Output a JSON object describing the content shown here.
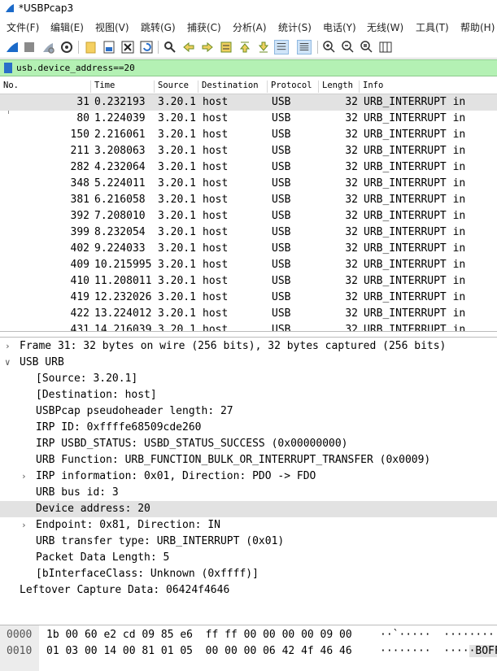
{
  "window": {
    "title": "*USBPcap3"
  },
  "menu": [
    "文件(F)",
    "编辑(E)",
    "视图(V)",
    "跳转(G)",
    "捕获(C)",
    "分析(A)",
    "统计(S)",
    "电话(Y)",
    "无线(W)",
    "工具(T)",
    "帮助(H)"
  ],
  "toolbar": {
    "icons": [
      "shark-fin-start-icon",
      "stop-icon",
      "restart-icon",
      "options-gear-icon",
      "open-folder-icon",
      "save-icon",
      "close-file-icon",
      "reload-icon",
      "find-icon",
      "back-arrow-icon",
      "forward-arrow-icon",
      "goto-packet-icon",
      "first-packet-icon",
      "last-packet-icon",
      "autoscroll-icon",
      "colorize-icon",
      "zoom-in-icon",
      "zoom-out-icon",
      "zoom-normal-icon",
      "resize-columns-icon"
    ]
  },
  "filter": {
    "value": "usb.device_address==20"
  },
  "columns": [
    "No.",
    "Time",
    "Source",
    "Destination",
    "Protocol",
    "Length",
    "Info"
  ],
  "packets": [
    {
      "no": "31",
      "time": "0.232193",
      "source": "3.20.1",
      "destination": "host",
      "protocol": "USB",
      "length": "32",
      "info": "URB_INTERRUPT in"
    },
    {
      "no": "80",
      "time": "1.224039",
      "source": "3.20.1",
      "destination": "host",
      "protocol": "USB",
      "length": "32",
      "info": "URB_INTERRUPT in"
    },
    {
      "no": "150",
      "time": "2.216061",
      "source": "3.20.1",
      "destination": "host",
      "protocol": "USB",
      "length": "32",
      "info": "URB_INTERRUPT in"
    },
    {
      "no": "211",
      "time": "3.208063",
      "source": "3.20.1",
      "destination": "host",
      "protocol": "USB",
      "length": "32",
      "info": "URB_INTERRUPT in"
    },
    {
      "no": "282",
      "time": "4.232064",
      "source": "3.20.1",
      "destination": "host",
      "protocol": "USB",
      "length": "32",
      "info": "URB_INTERRUPT in"
    },
    {
      "no": "348",
      "time": "5.224011",
      "source": "3.20.1",
      "destination": "host",
      "protocol": "USB",
      "length": "32",
      "info": "URB_INTERRUPT in"
    },
    {
      "no": "381",
      "time": "6.216058",
      "source": "3.20.1",
      "destination": "host",
      "protocol": "USB",
      "length": "32",
      "info": "URB_INTERRUPT in"
    },
    {
      "no": "392",
      "time": "7.208010",
      "source": "3.20.1",
      "destination": "host",
      "protocol": "USB",
      "length": "32",
      "info": "URB_INTERRUPT in"
    },
    {
      "no": "399",
      "time": "8.232054",
      "source": "3.20.1",
      "destination": "host",
      "protocol": "USB",
      "length": "32",
      "info": "URB_INTERRUPT in"
    },
    {
      "no": "402",
      "time": "9.224033",
      "source": "3.20.1",
      "destination": "host",
      "protocol": "USB",
      "length": "32",
      "info": "URB_INTERRUPT in"
    },
    {
      "no": "409",
      "time": "10.215995",
      "source": "3.20.1",
      "destination": "host",
      "protocol": "USB",
      "length": "32",
      "info": "URB_INTERRUPT in"
    },
    {
      "no": "410",
      "time": "11.208011",
      "source": "3.20.1",
      "destination": "host",
      "protocol": "USB",
      "length": "32",
      "info": "URB_INTERRUPT in"
    },
    {
      "no": "419",
      "time": "12.232026",
      "source": "3.20.1",
      "destination": "host",
      "protocol": "USB",
      "length": "32",
      "info": "URB_INTERRUPT in"
    },
    {
      "no": "422",
      "time": "13.224012",
      "source": "3.20.1",
      "destination": "host",
      "protocol": "USB",
      "length": "32",
      "info": "URB_INTERRUPT in"
    },
    {
      "no": "431",
      "time": "14.216039",
      "source": "3.20.1",
      "destination": "host",
      "protocol": "USB",
      "length": "32",
      "info": "URB_INTERRUPT in"
    }
  ],
  "details": [
    {
      "text": "Frame 31: 32 bytes on wire (256 bits), 32 bytes captured (256 bits)",
      "level": 0,
      "arrow": "collapsed"
    },
    {
      "text": "USB URB",
      "level": 0,
      "arrow": "expanded"
    },
    {
      "text": "[Source: 3.20.1]",
      "level": 1,
      "arrow": "none"
    },
    {
      "text": "[Destination: host]",
      "level": 1,
      "arrow": "none"
    },
    {
      "text": "USBPcap pseudoheader length: 27",
      "level": 1,
      "arrow": "none"
    },
    {
      "text": "IRP ID: 0xffffe68509cde260",
      "level": 1,
      "arrow": "none"
    },
    {
      "text": "IRP USBD_STATUS: USBD_STATUS_SUCCESS (0x00000000)",
      "level": 1,
      "arrow": "none"
    },
    {
      "text": "URB Function: URB_FUNCTION_BULK_OR_INTERRUPT_TRANSFER (0x0009)",
      "level": 1,
      "arrow": "none"
    },
    {
      "text": "IRP information: 0x01, Direction: PDO -> FDO",
      "level": 1,
      "arrow": "collapsed"
    },
    {
      "text": "URB bus id: 3",
      "level": 1,
      "arrow": "none"
    },
    {
      "text": "Device address: 20",
      "level": 1,
      "arrow": "none",
      "highlighted": true
    },
    {
      "text": "Endpoint: 0x81, Direction: IN",
      "level": 1,
      "arrow": "collapsed"
    },
    {
      "text": "URB transfer type: URB_INTERRUPT (0x01)",
      "level": 1,
      "arrow": "none"
    },
    {
      "text": "Packet Data Length: 5",
      "level": 1,
      "arrow": "none"
    },
    {
      "text": "[bInterfaceClass: Unknown (0xffff)]",
      "level": 1,
      "arrow": "none"
    },
    {
      "text": "Leftover Capture Data: 06424f4646",
      "level": 0,
      "arrow": "none"
    }
  ],
  "bytes": [
    {
      "offset": "0000",
      "hex": "1b 00 60 e2 cd 09 85 e6  ff ff 00 00 00 00 09 00",
      "ascii": "··`·····  ········"
    },
    {
      "offset": "0010",
      "hex": "01 03 00 14 00 81 01 05  00 00 00 06 42 4f 46 46",
      "ascii_plain": "········  ····",
      "ascii_hl": "·BOFF"
    }
  ],
  "colors": {
    "filter_valid_bg": "#b4f1b4",
    "selection_bg": "#e2e2e2"
  }
}
